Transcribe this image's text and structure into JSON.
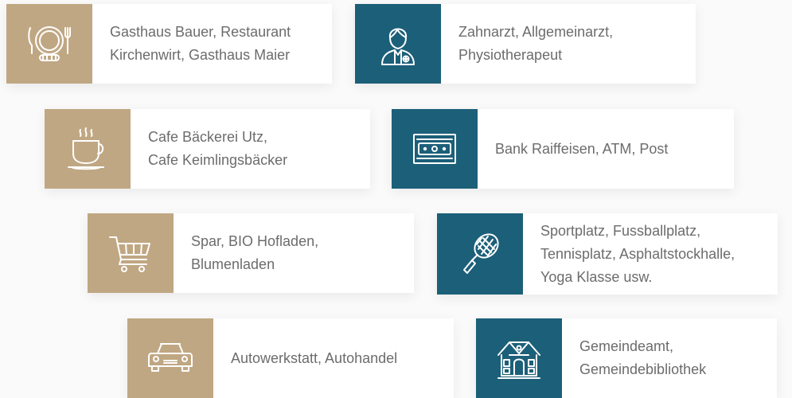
{
  "colors": {
    "tan": "#c0a783",
    "teal": "#1c5f79",
    "text": "#6c6c6c",
    "card": "#ffffff"
  },
  "cards": [
    {
      "icon": "plate-cutlery-icon",
      "theme": "tan",
      "lines": [
        "Gasthaus Bauer, Restaurant",
        "Kirchenwirt,  Gasthaus Maier"
      ]
    },
    {
      "icon": "doctor-icon",
      "theme": "teal",
      "lines": [
        "Zahnarzt, Allgemeinarzt,",
        "Physiotherapeut"
      ]
    },
    {
      "icon": "coffee-cup-icon",
      "theme": "tan",
      "lines": [
        "Cafe Bäckerei Utz,",
        "Cafe Keimlingsbäcker"
      ]
    },
    {
      "icon": "banknote-icon",
      "theme": "teal",
      "lines": [
        "Bank Raiffeisen, ATM, Post"
      ]
    },
    {
      "icon": "shopping-cart-icon",
      "theme": "tan",
      "lines": [
        "Spar, BIO Hofladen,",
        "Blumenladen"
      ]
    },
    {
      "icon": "tennis-racket-icon",
      "theme": "teal",
      "lines": [
        "Sportplatz, Fussballplatz,",
        "Tennisplatz, Asphaltstockhalle,",
        "Yoga Klasse usw."
      ]
    },
    {
      "icon": "car-icon",
      "theme": "tan",
      "lines": [
        "Autowerkstatt, Autohandel"
      ]
    },
    {
      "icon": "town-hall-icon",
      "theme": "teal",
      "lines": [
        "Gemeindeamt,",
        "Gemeindebibliothek"
      ]
    }
  ]
}
